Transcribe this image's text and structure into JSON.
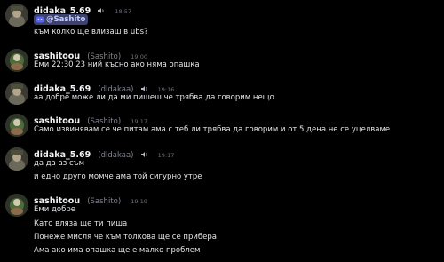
{
  "messages": [
    {
      "username": "didaka_5.69",
      "tag": "",
      "time": "18:57",
      "mention": "@Sashito",
      "lines": [
        "към колко ще влизаш в ubs?"
      ]
    },
    {
      "username": "sashitoou",
      "tag": "(Sashito)",
      "time": "19:00",
      "lines": [
        "Еми 22:30 23 ний късно ако няма опашка"
      ]
    },
    {
      "username": "didaka_5.69",
      "tag": "(dldakaa)",
      "time": "19:16",
      "lines": [
        "аа добре може ли да ми пишеш че трябва да говорим нещо"
      ]
    },
    {
      "username": "sashitoou",
      "tag": "(Sashito)",
      "time": "19:17",
      "lines": [
        "Само извинявам се че питам ама с теб ли трябва да говорим и от 5 дена не се уцелваме"
      ]
    },
    {
      "username": "didaka_5.69",
      "tag": "(dldakaa)",
      "time": "19:17",
      "lines": [
        "да да аз съм",
        "и едно друго момче ама той сигурно утре"
      ]
    },
    {
      "username": "sashitoou",
      "tag": "(Sashito)",
      "time": "19:19",
      "lines": [
        "Еми добре",
        "Като вляза ще ти пиша",
        "Понеже мисля че към толкова ще се прибера",
        "Ама ако има опашка ще е малко проблем"
      ]
    }
  ]
}
